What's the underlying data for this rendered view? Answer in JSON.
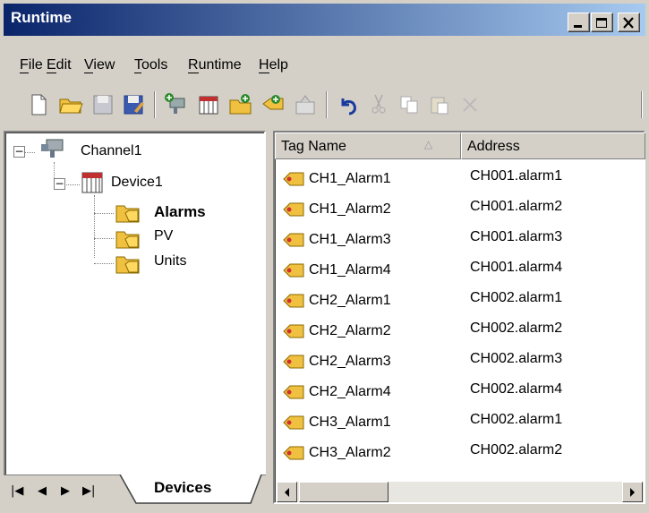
{
  "window": {
    "title": "Runtime"
  },
  "menubar": {
    "items": [
      "File",
      "Edit",
      "View",
      "Tools",
      "Runtime",
      "Help"
    ]
  },
  "toolbar": {
    "icons": [
      "new-icon",
      "open-icon",
      "save-icon",
      "save-as-icon",
      "new-channel-icon",
      "new-device-icon",
      "new-tag-group-icon",
      "new-tag-icon",
      "properties-icon",
      "undo-icon",
      "cut-icon",
      "copy-icon",
      "paste-icon",
      "delete-icon"
    ]
  },
  "tree": {
    "channel": "Channel1",
    "device": "Device1",
    "groups": [
      "Alarms",
      "PV",
      "Units"
    ],
    "selected": "Alarms"
  },
  "tabstrip": {
    "tab": "Devices"
  },
  "table": {
    "columns": [
      "Tag Name",
      "Address"
    ],
    "rows": [
      {
        "name": "CH1_Alarm1",
        "address": "CH001.alarm1"
      },
      {
        "name": "CH1_Alarm2",
        "address": "CH001.alarm2"
      },
      {
        "name": "CH1_Alarm3",
        "address": "CH001.alarm3"
      },
      {
        "name": "CH1_Alarm4",
        "address": "CH001.alarm4"
      },
      {
        "name": "CH2_Alarm1",
        "address": "CH002.alarm1"
      },
      {
        "name": "CH2_Alarm2",
        "address": "CH002.alarm2"
      },
      {
        "name": "CH2_Alarm3",
        "address": "CH002.alarm3"
      },
      {
        "name": "CH2_Alarm4",
        "address": "CH002.alarm4"
      },
      {
        "name": "CH3_Alarm1",
        "address": "CH002.alarm1"
      },
      {
        "name": "CH3_Alarm2",
        "address": "CH002.alarm2"
      }
    ]
  },
  "colors": {
    "titlebar_start": "#0a246a",
    "titlebar_end": "#a6caf0",
    "face": "#d4d0c8"
  }
}
